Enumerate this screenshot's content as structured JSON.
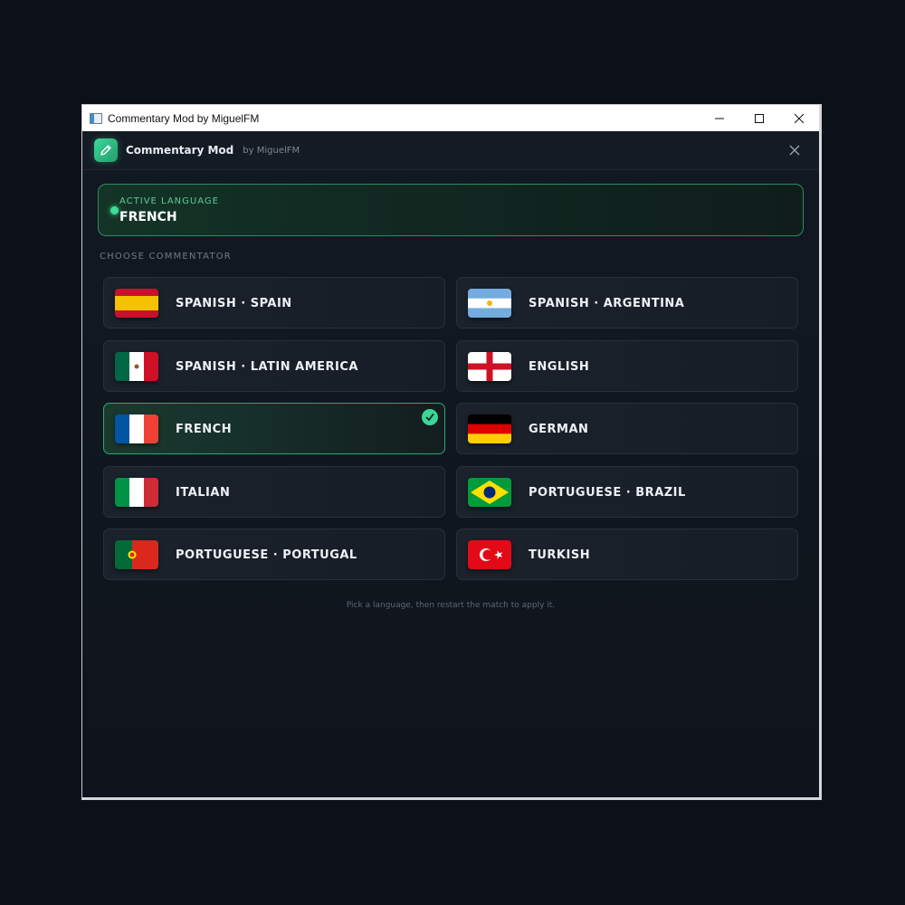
{
  "window": {
    "title": "Commentary Mod by MiguelFM"
  },
  "header": {
    "title": "Commentary Mod",
    "subtitle": "by MiguelFM",
    "logo_icon": "pencil-icon"
  },
  "active_language": {
    "label": "ACTIVE LANGUAGE",
    "value": "FRENCH"
  },
  "commentators": {
    "section_label": "CHOOSE COMMENTATOR",
    "selected": "FRENCH",
    "items": [
      {
        "label": "SPANISH · SPAIN",
        "flag": "spain-flag-icon"
      },
      {
        "label": "SPANISH · ARGENTINA",
        "flag": "argentina-flag-icon"
      },
      {
        "label": "SPANISH · LATIN AMERICA",
        "flag": "mexico-flag-icon"
      },
      {
        "label": "ENGLISH",
        "flag": "england-flag-icon"
      },
      {
        "label": "FRENCH",
        "flag": "france-flag-icon"
      },
      {
        "label": "GERMAN",
        "flag": "germany-flag-icon"
      },
      {
        "label": "ITALIAN",
        "flag": "italy-flag-icon"
      },
      {
        "label": "PORTUGUESE · BRAZIL",
        "flag": "brazil-flag-icon"
      },
      {
        "label": "PORTUGUESE · PORTUGAL",
        "flag": "portugal-flag-icon"
      },
      {
        "label": "TURKISH",
        "flag": "turkey-flag-icon"
      }
    ]
  },
  "hint": "Pick a language, then restart the match to apply it.",
  "colors": {
    "accent": "#3ddc97",
    "background": "#0c1018",
    "card": "#1b222c"
  }
}
